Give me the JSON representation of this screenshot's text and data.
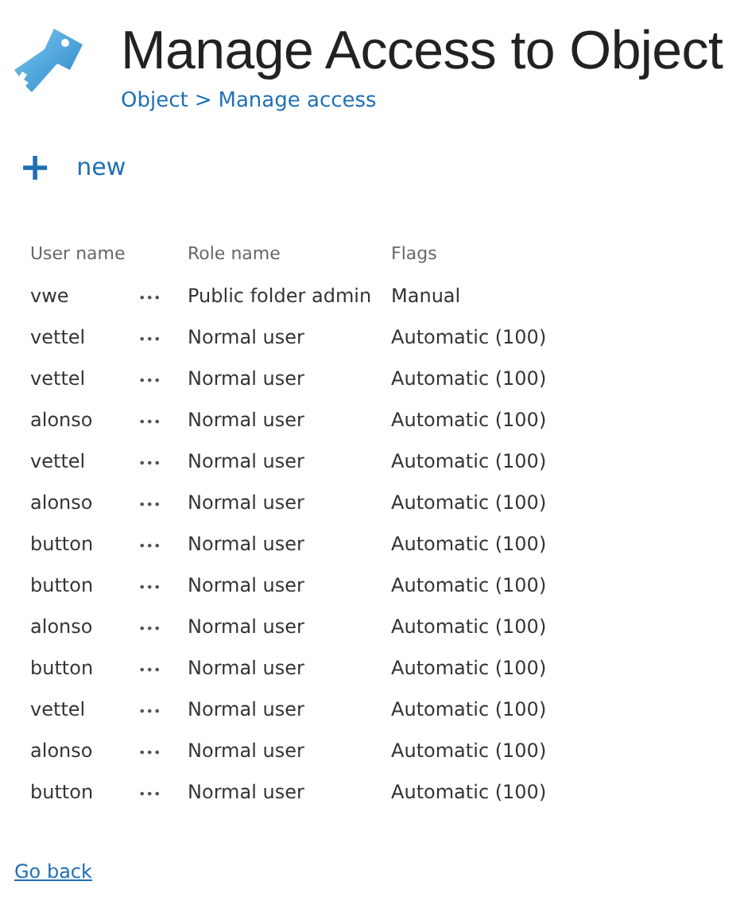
{
  "header": {
    "title": "Manage Access to Object",
    "breadcrumb": [
      {
        "label": "Object"
      },
      {
        "label": "Manage access"
      }
    ],
    "breadcrumb_separator": ">"
  },
  "toolbar": {
    "new_icon": "+",
    "new_label": "new"
  },
  "table": {
    "columns": [
      "User name",
      "Role name",
      "Flags"
    ],
    "menu_glyph": "•••",
    "rows": [
      {
        "user": "vwe",
        "role": "Public folder admin",
        "flags": "Manual"
      },
      {
        "user": "vettel",
        "role": "Normal user",
        "flags": "Automatic (100)"
      },
      {
        "user": "vettel",
        "role": "Normal user",
        "flags": "Automatic (100)"
      },
      {
        "user": "alonso",
        "role": "Normal user",
        "flags": "Automatic (100)"
      },
      {
        "user": "vettel",
        "role": "Normal user",
        "flags": "Automatic (100)"
      },
      {
        "user": "alonso",
        "role": "Normal user",
        "flags": "Automatic (100)"
      },
      {
        "user": "button",
        "role": "Normal user",
        "flags": "Automatic (100)"
      },
      {
        "user": "button",
        "role": "Normal user",
        "flags": "Automatic (100)"
      },
      {
        "user": "alonso",
        "role": "Normal user",
        "flags": "Automatic (100)"
      },
      {
        "user": "button",
        "role": "Normal user",
        "flags": "Automatic (100)"
      },
      {
        "user": "vettel",
        "role": "Normal user",
        "flags": "Automatic (100)"
      },
      {
        "user": "alonso",
        "role": "Normal user",
        "flags": "Automatic (100)"
      },
      {
        "user": "button",
        "role": "Normal user",
        "flags": "Automatic (100)"
      }
    ]
  },
  "footer": {
    "back_link": "Go back"
  }
}
